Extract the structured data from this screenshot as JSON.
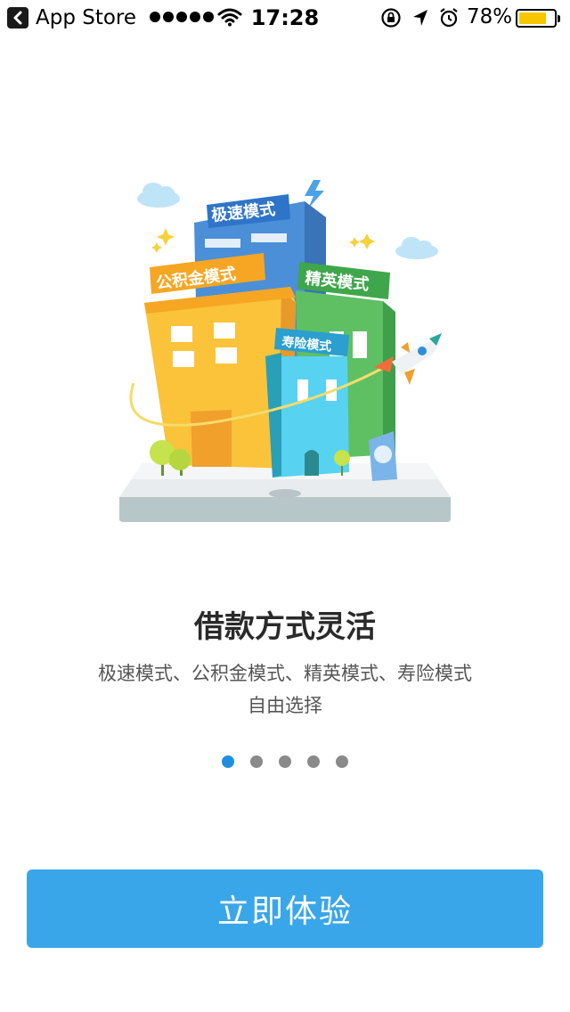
{
  "status_bar": {
    "back_app_label": "App Store",
    "time": "17:28",
    "battery_percent": "78%",
    "battery_level": 0.78,
    "battery_color": "#f7c600"
  },
  "illustration": {
    "sign_fast": "极速模式",
    "sign_fund": "公积金模式",
    "sign_elite": "精英模式",
    "sign_insurance": "寿险模式"
  },
  "onboarding": {
    "headline": "借款方式灵活",
    "subtitle_line1": "极速模式、公积金模式、精英模式、寿险模式",
    "subtitle_line2": "自由选择",
    "page_count": 5,
    "active_page": 1,
    "accent_color": "#1e8fe0"
  },
  "cta": {
    "label": "立即体验",
    "color": "#3aa6ea"
  }
}
